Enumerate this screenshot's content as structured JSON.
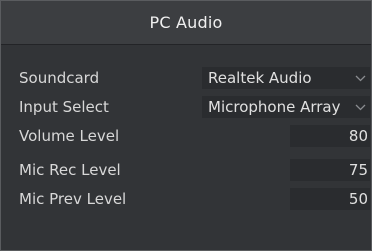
{
  "window": {
    "title": "PC Audio"
  },
  "fields": {
    "soundcard": {
      "label": "Soundcard",
      "value": "Realtek Audio"
    },
    "input_select": {
      "label": "Input Select",
      "value": "Microphone Array"
    },
    "volume_level": {
      "label": "Volume Level",
      "value": "80"
    },
    "mic_rec_level": {
      "label": "Mic Rec Level",
      "value": "75"
    },
    "mic_prev_level": {
      "label": "Mic Prev Level",
      "value": "50"
    }
  },
  "icons": {
    "dropdown": "chevron-down-icon"
  },
  "colors": {
    "background": "#323437",
    "title_bar": "#3c3e41",
    "field_background": "#2a2c2f",
    "text": "#dcdcdc"
  }
}
